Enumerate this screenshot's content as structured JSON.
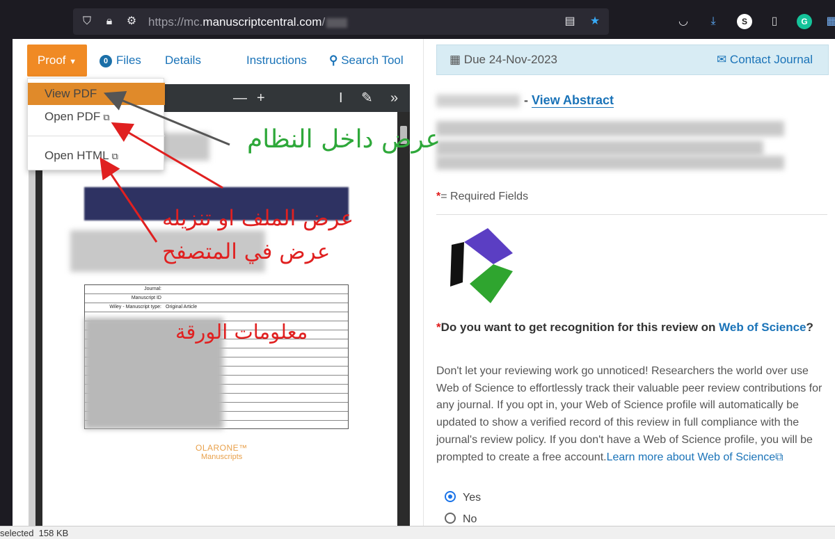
{
  "browser": {
    "url_prefix": "https://mc.",
    "url_host": "manuscriptcentral.com",
    "url_suffix": "/",
    "profile_initial": "S",
    "extension_initial": "G"
  },
  "left": {
    "proof_label": "Proof",
    "files_count": "0",
    "files_label": "Files",
    "details_label": "Details",
    "instructions_label": "Instructions",
    "search_tool_label": "Search Tool",
    "dropdown": {
      "view_pdf": "View PDF",
      "open_pdf": "Open PDF",
      "open_html": "Open HTML"
    },
    "pdf_form": [
      {
        "k": "Journal:",
        "v": ""
      },
      {
        "k": "Manuscript ID",
        "v": ""
      },
      {
        "k": "Wiley - Manuscript type:",
        "v": "Original Article"
      }
    ],
    "pdf_logo": "OLARONE™",
    "pdf_logo_sub": "Manuscripts"
  },
  "annotations": {
    "green": "عرض داخل النظام",
    "red1": "عرض الملف او تنزيله",
    "red2": "عرض في المتصفح",
    "red3": "معلومات الورقة"
  },
  "right": {
    "due": "Due 24-Nov-2023",
    "contact": "Contact Journal",
    "abstract_sep": "- ",
    "view_abstract": "View Abstract",
    "required_star": "*",
    "required_text": "= Required Fields",
    "question_star": "*",
    "question_text": "Do you want to get recognition for this review on ",
    "question_link": "Web of Science",
    "question_end": "?",
    "paragraph": "Don't let your reviewing work go unnoticed! Researchers the world over use Web of Science to effortlessly track their valuable peer review contributions for any journal. If you opt in, your Web of Science profile will automatically be updated to show a verified record of this review in full compliance with the journal's review policy. If you don't have a Web of Science profile, you will be prompted to create a free account.",
    "learn_more": "Learn more about Web of Science",
    "yes": "Yes",
    "no": "No"
  },
  "status": {
    "text": "selected  158 KB"
  },
  "colors": {
    "proof_orange": "#f08a24",
    "link_blue": "#1a73b8",
    "due_bg": "#d8ecf4"
  }
}
